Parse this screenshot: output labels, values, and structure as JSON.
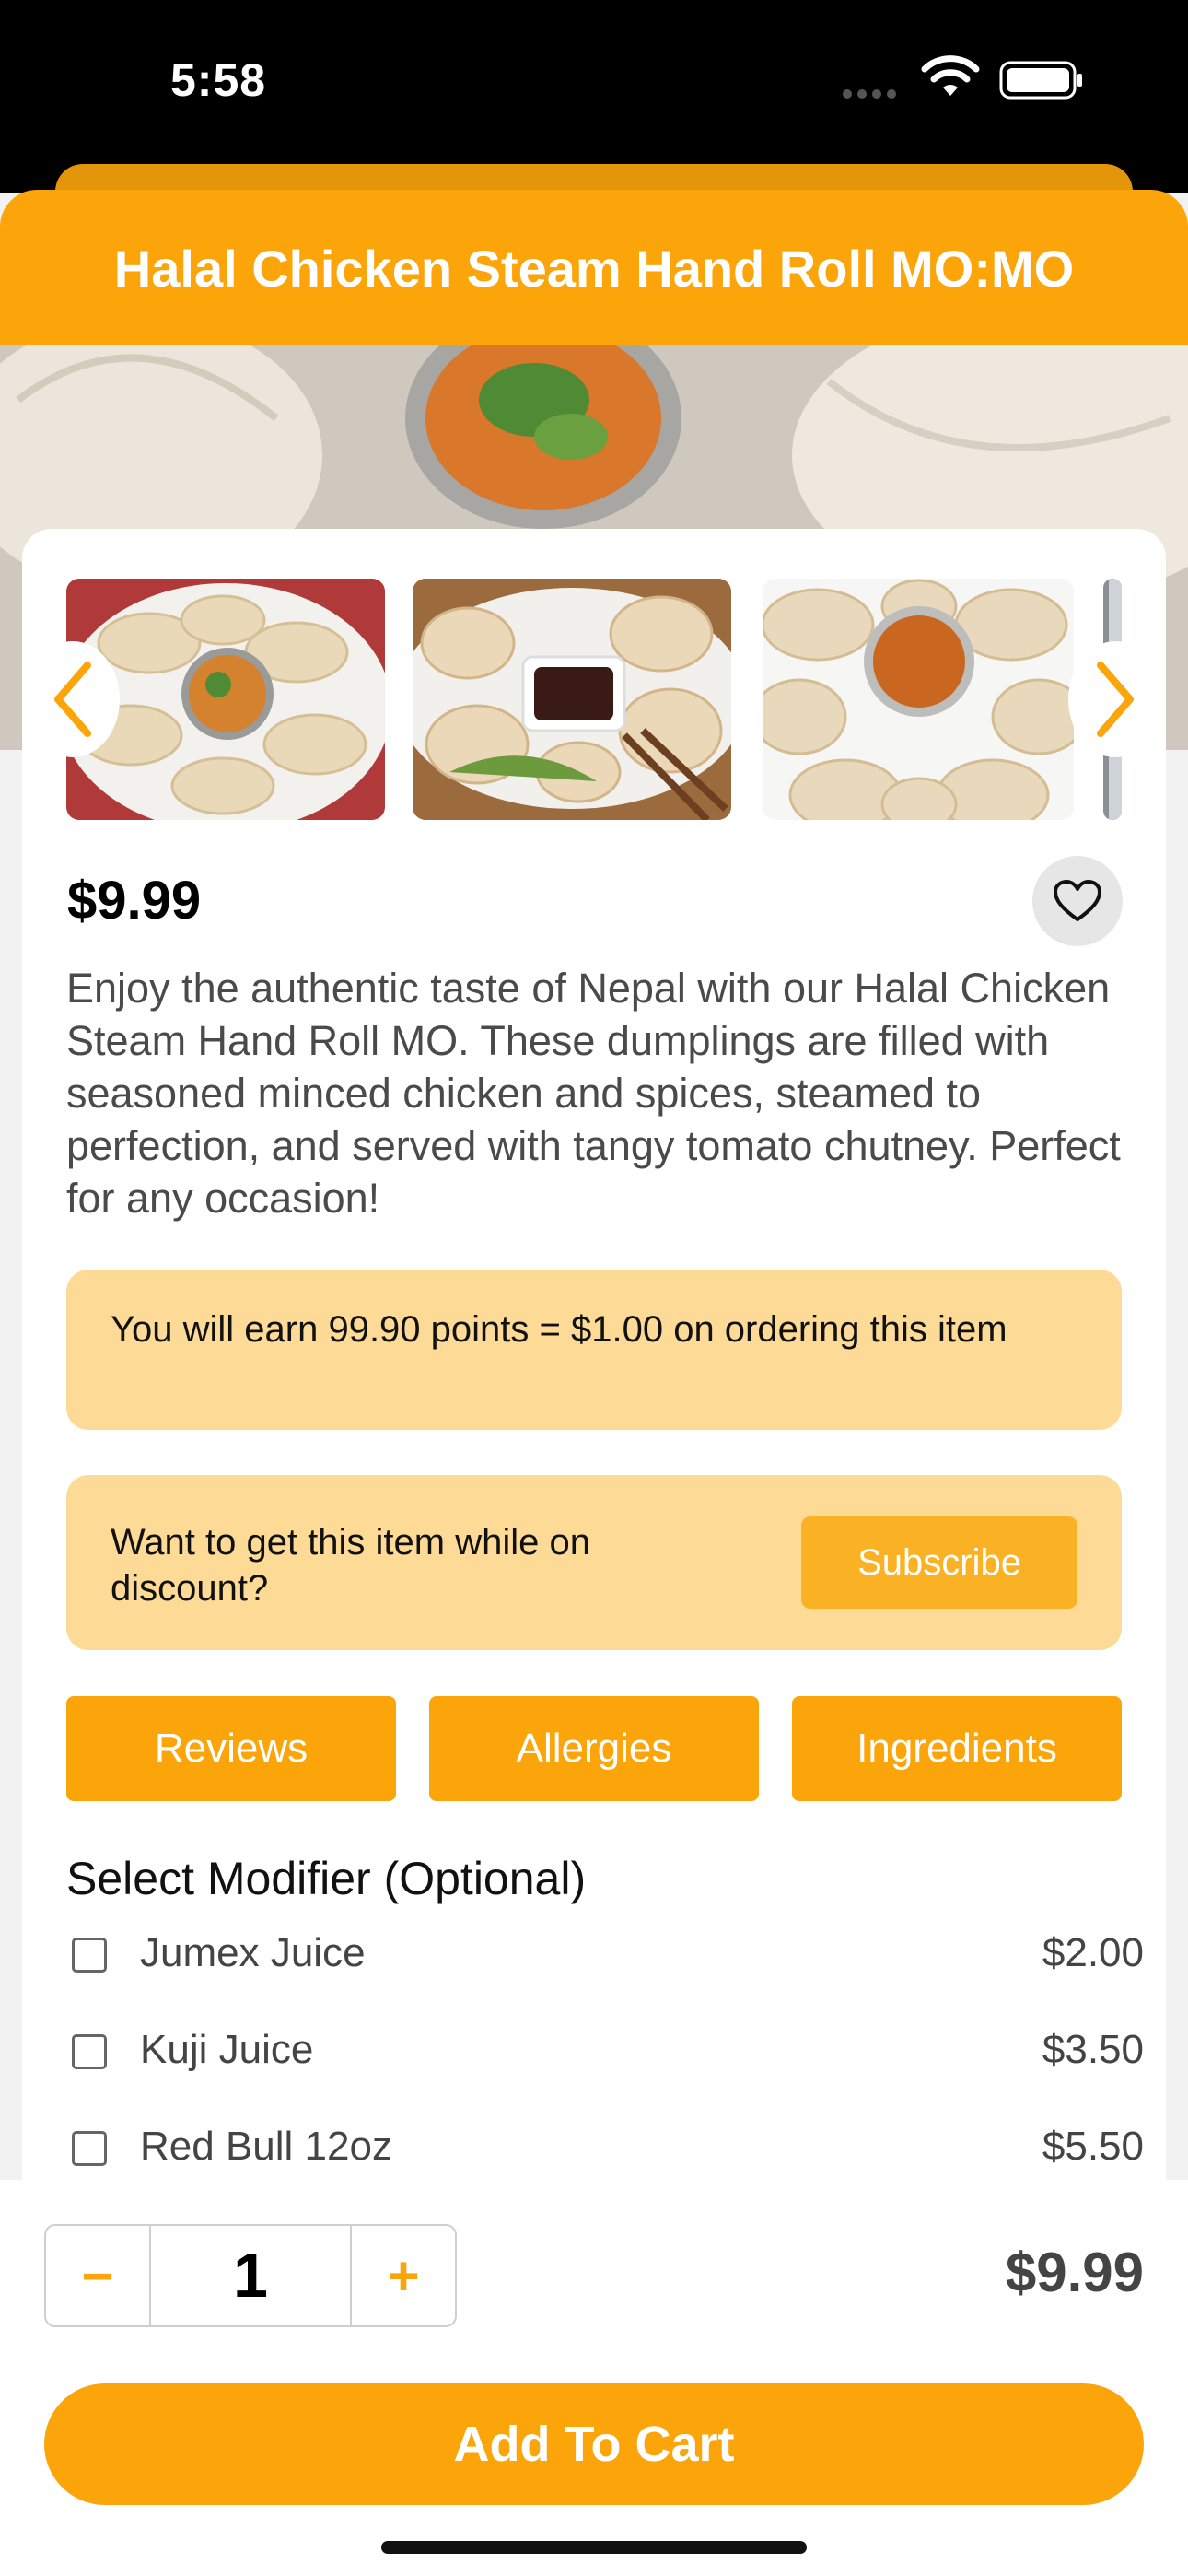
{
  "status_bar": {
    "time": "5:58"
  },
  "header": {
    "title": "Halal Chicken Steam Hand Roll MO:MO"
  },
  "product": {
    "price": "$9.99",
    "description": "Enjoy the authentic taste of Nepal with our Halal Chicken Steam Hand Roll MO. These dumplings are filled with seasoned minced chicken and spices, steamed to perfection, and served with tangy tomato chutney. Perfect for any occasion!"
  },
  "points_banner": {
    "text": "You will earn 99.90 points = $1.00 on ordering this item"
  },
  "discount_banner": {
    "text": "Want to get this item while on discount?",
    "button": "Subscribe"
  },
  "tabs": [
    "Reviews",
    "Allergies",
    "Ingredients"
  ],
  "modifiers": {
    "title": "Select Modifier (Optional)",
    "items": [
      {
        "name": "Jumex Juice",
        "price": "$2.00",
        "checked": false
      },
      {
        "name": "Kuji Juice",
        "price": "$3.50",
        "checked": false
      },
      {
        "name": "Red Bull 12oz",
        "price": "$5.50",
        "checked": false
      }
    ]
  },
  "cart": {
    "minus": "−",
    "quantity": "1",
    "plus": "+",
    "total": "$9.99",
    "add_button": "Add To Cart"
  },
  "colors": {
    "accent": "#fba50a",
    "banner": "#fddb96"
  }
}
